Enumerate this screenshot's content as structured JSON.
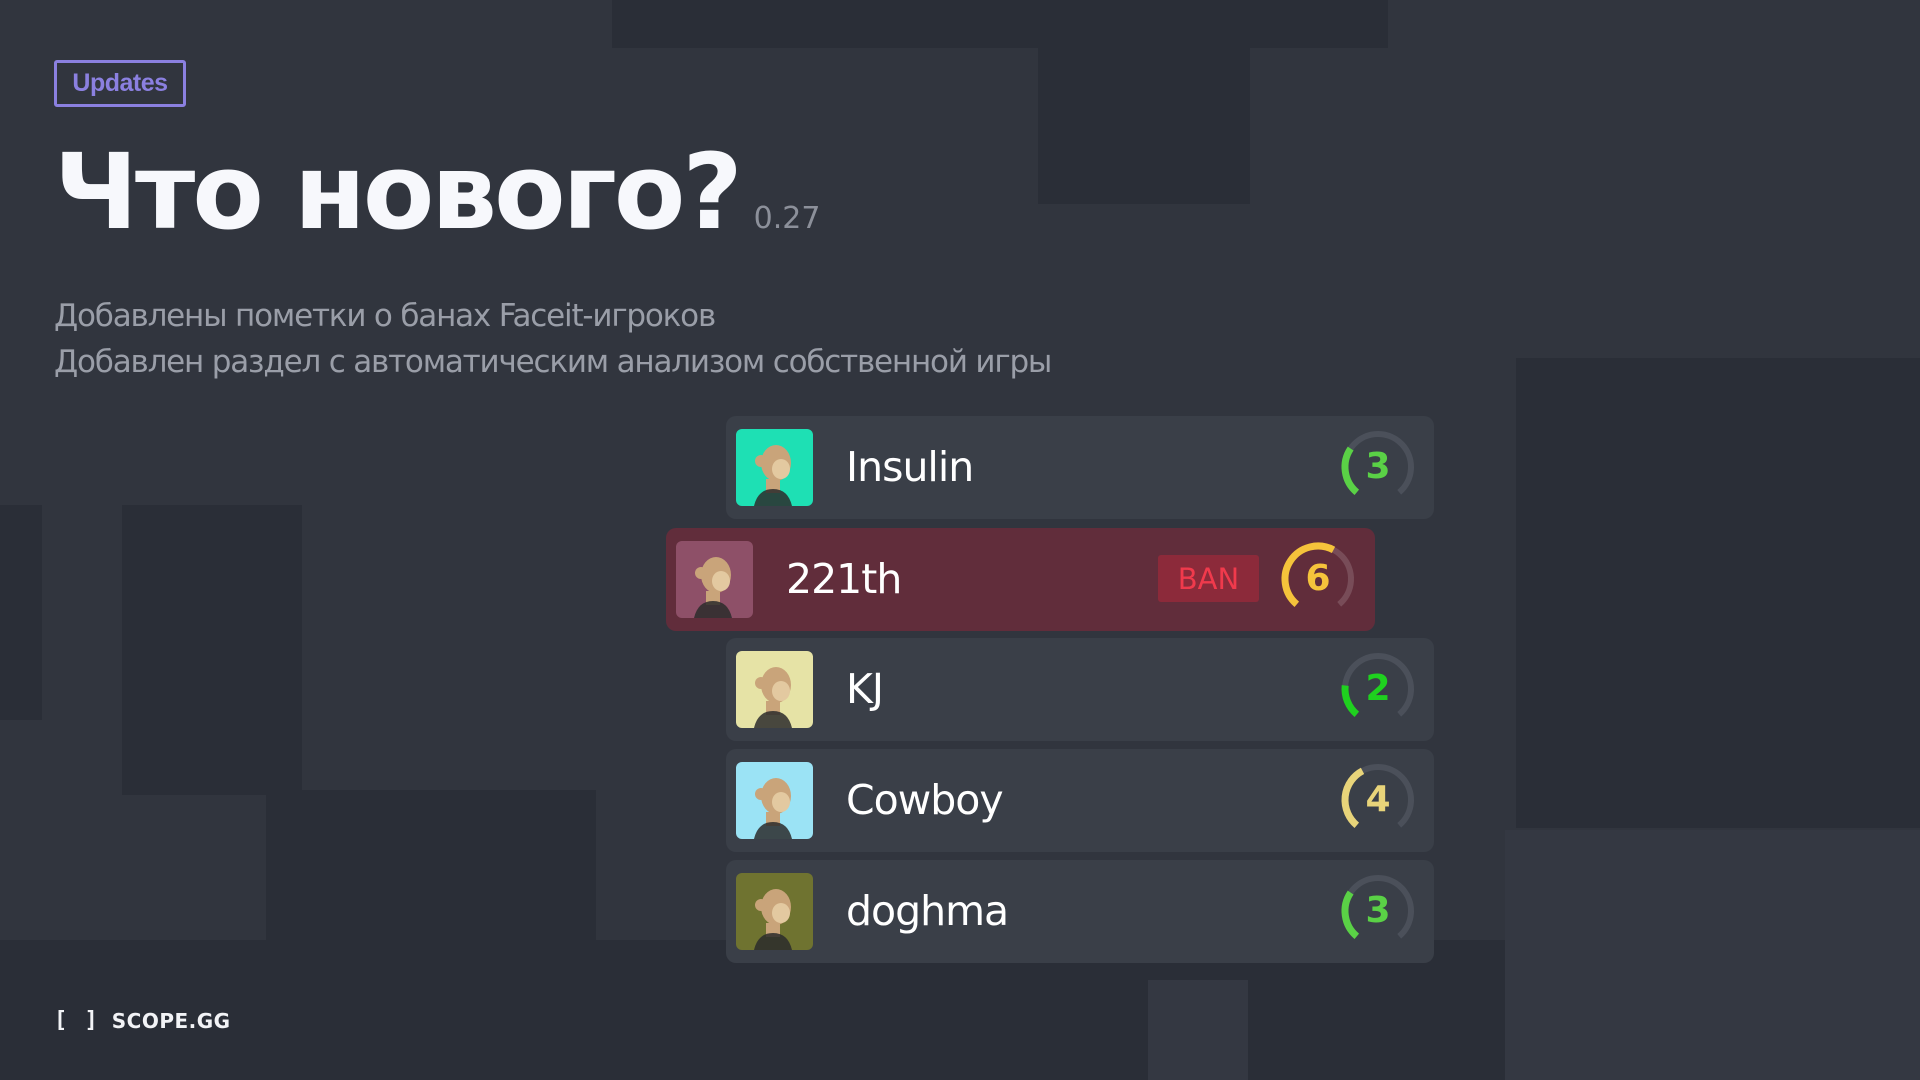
{
  "badge": {
    "label": "Updates",
    "color": "#8b80e0"
  },
  "header": {
    "title": "Что нового?",
    "version": "0.27"
  },
  "changes": [
    "Добавлены пометки о банах Faceit-игроков",
    "Добавлен раздел с автоматическим анализом собственной игры"
  ],
  "players": [
    {
      "name": "Insulin",
      "level": 3,
      "level_max": 10,
      "banned": false,
      "gauge_color": "#5ad146",
      "avatar_bg": "#1ee0b4",
      "avatar_icon": "ape-avatar-red-cap"
    },
    {
      "name": "221th",
      "level": 6,
      "level_max": 10,
      "banned": true,
      "ban_label": "BAN",
      "gauge_color": "#f5c33b",
      "avatar_bg": "#8e5068",
      "avatar_icon": "ape-avatar-leopard"
    },
    {
      "name": "KJ",
      "level": 2,
      "level_max": 10,
      "banned": false,
      "gauge_color": "#1fd11f",
      "avatar_bg": "#e6e3a6",
      "avatar_icon": "ape-avatar-eyepatch"
    },
    {
      "name": "Cowboy",
      "level": 4,
      "level_max": 10,
      "banned": false,
      "gauge_color": "#e8d47a",
      "avatar_bg": "#9be3f5",
      "avatar_icon": "ape-avatar-mohawk"
    },
    {
      "name": "doghma",
      "level": 3,
      "level_max": 10,
      "banned": false,
      "gauge_color": "#5ad146",
      "avatar_bg": "#6f7330",
      "avatar_icon": "ape-avatar-headband"
    }
  ],
  "footer": {
    "logo_mark": "[ ]",
    "logo_text": "SCOPE.GG"
  }
}
